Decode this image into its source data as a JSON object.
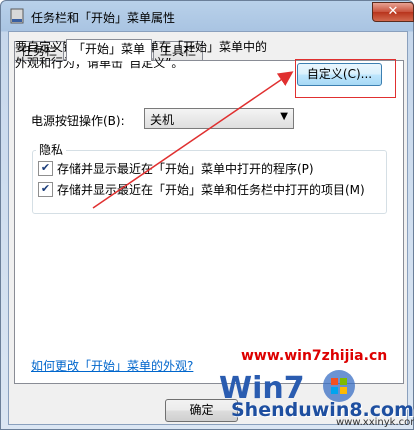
{
  "window": {
    "title": "任务栏和「开始」菜单属性",
    "close_symbol": "✕"
  },
  "tabs": [
    {
      "label": "任务栏"
    },
    {
      "label": "「开始」菜单"
    },
    {
      "label": "工具栏"
    }
  ],
  "start_menu": {
    "description_line1": "要自定义链接、图标和菜单在「开始」菜单中的",
    "description_line2": "外观和行为，请单击“自定义”。",
    "customize_button": "自定义(C)...",
    "power_label": "电源按钮操作(B):",
    "power_value": "关机",
    "privacy": {
      "title": "隐私",
      "option1": "存储并显示最近在「开始」菜单中打开的程序(P)",
      "option2": "存储并显示最近在「开始」菜单和任务栏中打开的项目(M)",
      "option1_checked": true,
      "option2_checked": true
    },
    "help_link": "如何更改「开始」菜单的外观?"
  },
  "footer": {
    "ok_button": "确定"
  },
  "watermarks": {
    "site1": "www.win7zhijia.cn",
    "site2": "Shenduwin8.com",
    "site3": "www.xxinyk.com"
  },
  "check_mark": "✔",
  "colors": {
    "annotation_red": "#e03030",
    "link_blue": "#0066cc"
  }
}
